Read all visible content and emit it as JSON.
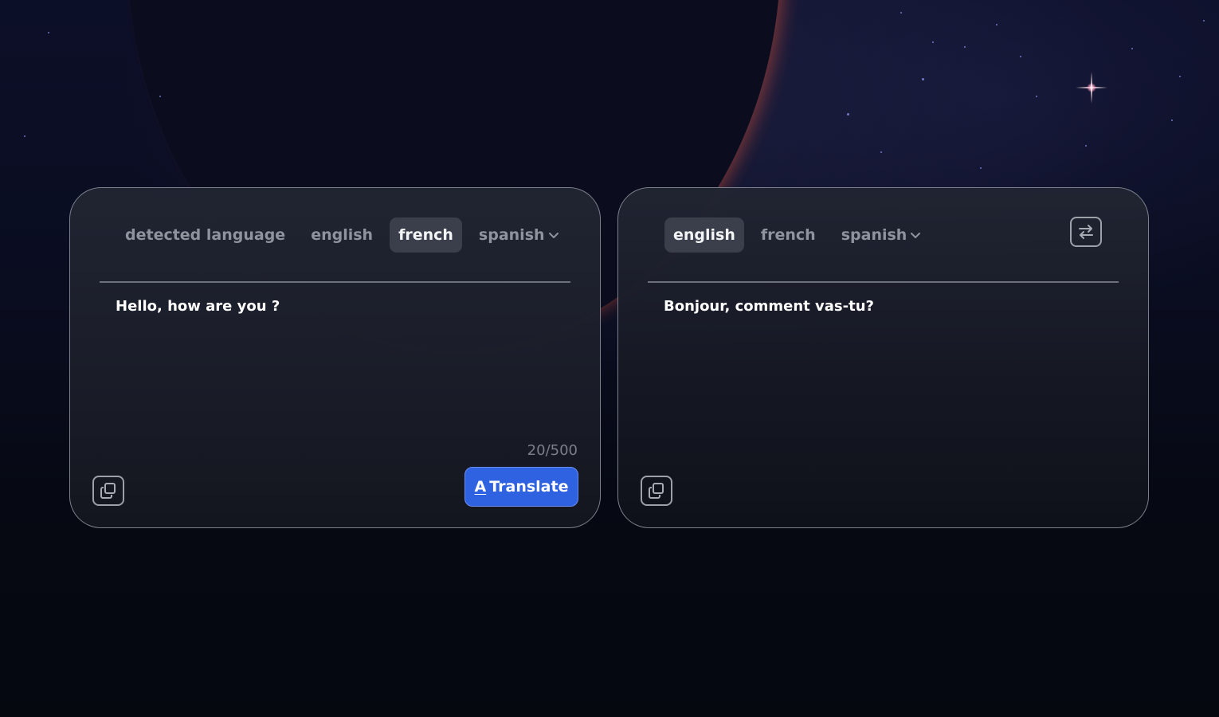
{
  "source": {
    "languages": [
      {
        "label": "detected language",
        "active": false
      },
      {
        "label": "english",
        "active": false
      },
      {
        "label": "french",
        "active": true
      },
      {
        "label": "spanish",
        "active": false,
        "dropdown": true
      }
    ],
    "text": "Hello, how are you ?",
    "counter": "20/500",
    "translate_label": "Translate",
    "translate_icon": "A",
    "copy_icon": "copy-icon"
  },
  "target": {
    "languages": [
      {
        "label": "english",
        "active": true
      },
      {
        "label": "french",
        "active": false
      },
      {
        "label": "spanish",
        "active": false,
        "dropdown": true
      }
    ],
    "text": "Bonjour, comment vas-tu?",
    "copy_icon": "copy-icon",
    "swap_icon": "swap-icon"
  },
  "colors": {
    "accent": "#2f62e0",
    "active_tab_bg": "#3b3f4b"
  }
}
